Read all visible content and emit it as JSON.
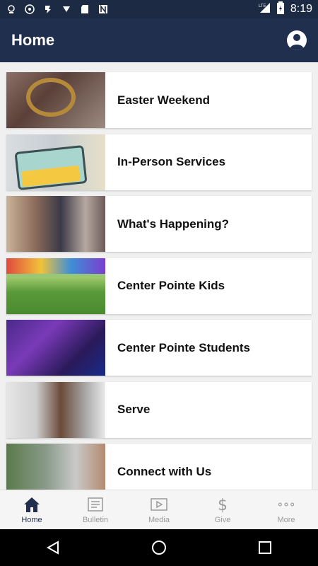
{
  "status_bar": {
    "time": "8:19",
    "network": "LTE",
    "icons": [
      "notification-icon",
      "location-icon",
      "cast-icon",
      "download-icon",
      "sd-card-icon",
      "n-app-icon"
    ]
  },
  "header": {
    "title": "Home"
  },
  "cards": [
    {
      "label": "Easter Weekend"
    },
    {
      "label": "In-Person Services"
    },
    {
      "label": "What's Happening?"
    },
    {
      "label": "Center Pointe Kids"
    },
    {
      "label": "Center Pointe Students"
    },
    {
      "label": "Serve"
    },
    {
      "label": "Connect with Us"
    }
  ],
  "bottom_nav": {
    "items": [
      {
        "label": "Home",
        "icon": "home-icon",
        "active": true
      },
      {
        "label": "Bulletin",
        "icon": "bulletin-icon",
        "active": false
      },
      {
        "label": "Media",
        "icon": "media-icon",
        "active": false
      },
      {
        "label": "Give",
        "icon": "dollar-icon",
        "active": false
      },
      {
        "label": "More",
        "icon": "more-dots-icon",
        "active": false
      }
    ]
  },
  "colors": {
    "header_bg": "#1f2f4d",
    "status_bg": "#1c2a44",
    "active_nav": "#1f2f4d",
    "inactive_nav": "#9a9a9a"
  }
}
